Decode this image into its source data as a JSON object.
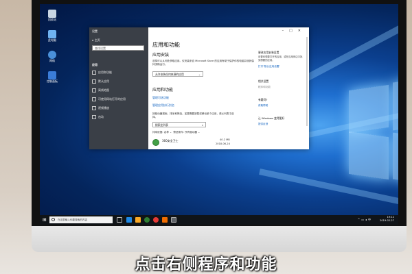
{
  "desktop": {
    "icons": [
      {
        "label": "回收站",
        "color": "#c9d6e3"
      },
      {
        "label": "此电脑",
        "color": "#6fb2f0"
      },
      {
        "label": "网络",
        "color": "#4a90d9"
      },
      {
        "label": "控制面板",
        "color": "#3b7dd8"
      }
    ]
  },
  "window": {
    "title": "设置",
    "sidebar": {
      "home": "主页",
      "search_placeholder": "查找设置",
      "section": "应用",
      "items": [
        {
          "label": "应用和功能",
          "icon": "list-icon"
        },
        {
          "label": "默认应用",
          "icon": "default-apps-icon"
        },
        {
          "label": "离线地图",
          "icon": "map-icon"
        },
        {
          "label": "可使用网站打开的应用",
          "icon": "websites-icon"
        },
        {
          "label": "视频播放",
          "icon": "video-icon"
        },
        {
          "label": "启动",
          "icon": "startup-icon"
        }
      ]
    },
    "main": {
      "heading": "应用和功能",
      "install_heading": "应用安装",
      "install_desc": "选择可以从何处获取应用。仅安装来自 Microsoft Store 的应用有助于保护你的电脑并使其保持流畅运行。",
      "install_dropdown": "允许安装任何来源的应用",
      "features_heading": "应用和功能",
      "link_optional": "管理可选功能",
      "link_aliases": "管理应用执行别名",
      "search_desc": "按驱动器搜索、排序和筛选。如果需要卸载或移动某个应用，请从列表中选择。",
      "search_placeholder": "搜索此列表",
      "sort_by": "排序依据: 名称",
      "filter_by": "筛选条件: 所有驱动器",
      "app": {
        "name": "360安全卫士",
        "size": "40.2 MB",
        "date": "2018-06-24"
      }
    },
    "right": {
      "related_title": "更改应用安装设置",
      "related_desc": "设置你想要打开的应用，或在应用商店中找到想要的应用。",
      "related_link": "打开\"默认应用设置\"",
      "related2_title": "相关设置",
      "related2_link": "程序和功能",
      "question_title": "有疑问?",
      "question_link": "获取帮助",
      "improve_title": "让 Windows 变得更好",
      "improve_link": "提供反馈"
    }
  },
  "taskbar": {
    "search_placeholder": "在这里输入你要搜索的内容",
    "time": "19:12",
    "date": "2019-02-27"
  },
  "caption": "点击右侧程序和功能"
}
